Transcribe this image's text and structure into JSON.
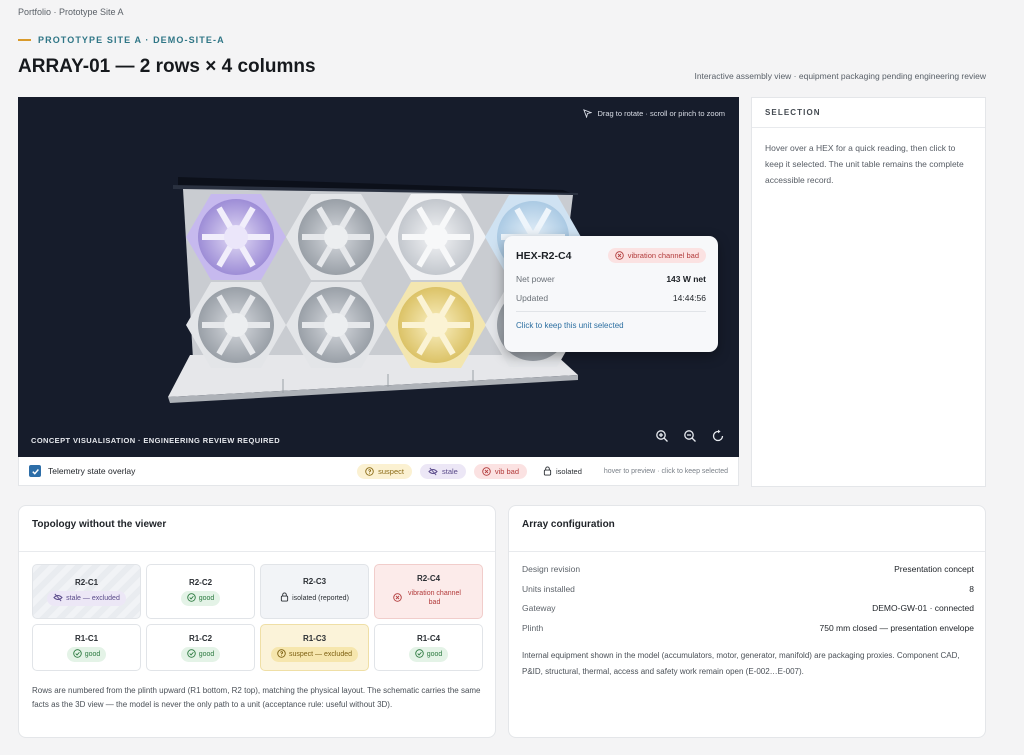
{
  "breadcrumb": "Portfolio · Prototype Site A",
  "eyebrow": "PROTOTYPE SITE A · DEMO-SITE-A",
  "page_title": "ARRAY-01 — 2 rows × 4 columns",
  "page_subtitle": "Interactive assembly view · equipment packaging pending engineering review",
  "viewer": {
    "hint": "Drag to rotate · scroll or pinch to zoom",
    "caption": "CONCEPT VISUALISATION · ENGINEERING REVIEW REQUIRED",
    "tooltip": {
      "unit": "HEX-R2-C4",
      "badge": "vibration channel bad",
      "net_power_label": "Net power",
      "net_power_value": "143 W net",
      "updated_label": "Updated",
      "updated_value": "14:44:56",
      "cta": "Click to keep this unit selected"
    }
  },
  "legend": {
    "overlay_label": "Telemetry state overlay",
    "overlay_checked": true,
    "chips": {
      "suspect": "suspect",
      "stale": "stale",
      "vib": "vib bad",
      "isolated": "isolated"
    },
    "help": "hover to preview · click to keep selected"
  },
  "selection": {
    "header": "SELECTION",
    "body": "Hover over a HEX for a quick reading, then click to keep it selected. The unit table remains the complete accessible record."
  },
  "topology": {
    "title": "Topology without the viewer",
    "cells": [
      {
        "id": "R2-C1",
        "status": "stale — excluded",
        "kind": "stale"
      },
      {
        "id": "R2-C2",
        "status": "good",
        "kind": "good"
      },
      {
        "id": "R2-C3",
        "status": "isolated (reported)",
        "kind": "isolated"
      },
      {
        "id": "R2-C4",
        "status": "vibration channel bad",
        "kind": "vib"
      },
      {
        "id": "R1-C1",
        "status": "good",
        "kind": "good"
      },
      {
        "id": "R1-C2",
        "status": "good",
        "kind": "good"
      },
      {
        "id": "R1-C3",
        "status": "suspect — excluded",
        "kind": "suspect"
      },
      {
        "id": "R1-C4",
        "status": "good",
        "kind": "good"
      }
    ],
    "note": "Rows are numbered from the plinth upward (R1 bottom, R2 top), matching the physical layout. The schematic carries the same facts as the 3D view — the model is never the only path to a unit (acceptance rule: useful without 3D)."
  },
  "config": {
    "title": "Array configuration",
    "rows": [
      {
        "k": "Design revision",
        "v": "Presentation concept"
      },
      {
        "k": "Units installed",
        "v": "8"
      },
      {
        "k": "Gateway",
        "v": "DEMO-GW-01 · connected"
      },
      {
        "k": "Plinth",
        "v": "750 mm closed — presentation envelope"
      }
    ],
    "note": "Internal equipment shown in the model (accumulators, motor, generator, manifold) are packaging proxies. Component CAD, P&ID, structural, thermal, access and safety work remain open (E-002…E-007)."
  },
  "colors": {
    "accent": "#2f7686",
    "eyebrow_dash": "#d99a2b",
    "viewer_bg": "#161c2b",
    "stale": "#9d8ad8",
    "suspect": "#e8d27a",
    "vib_bad": "#b23b3b",
    "good": "#2c7a40"
  }
}
